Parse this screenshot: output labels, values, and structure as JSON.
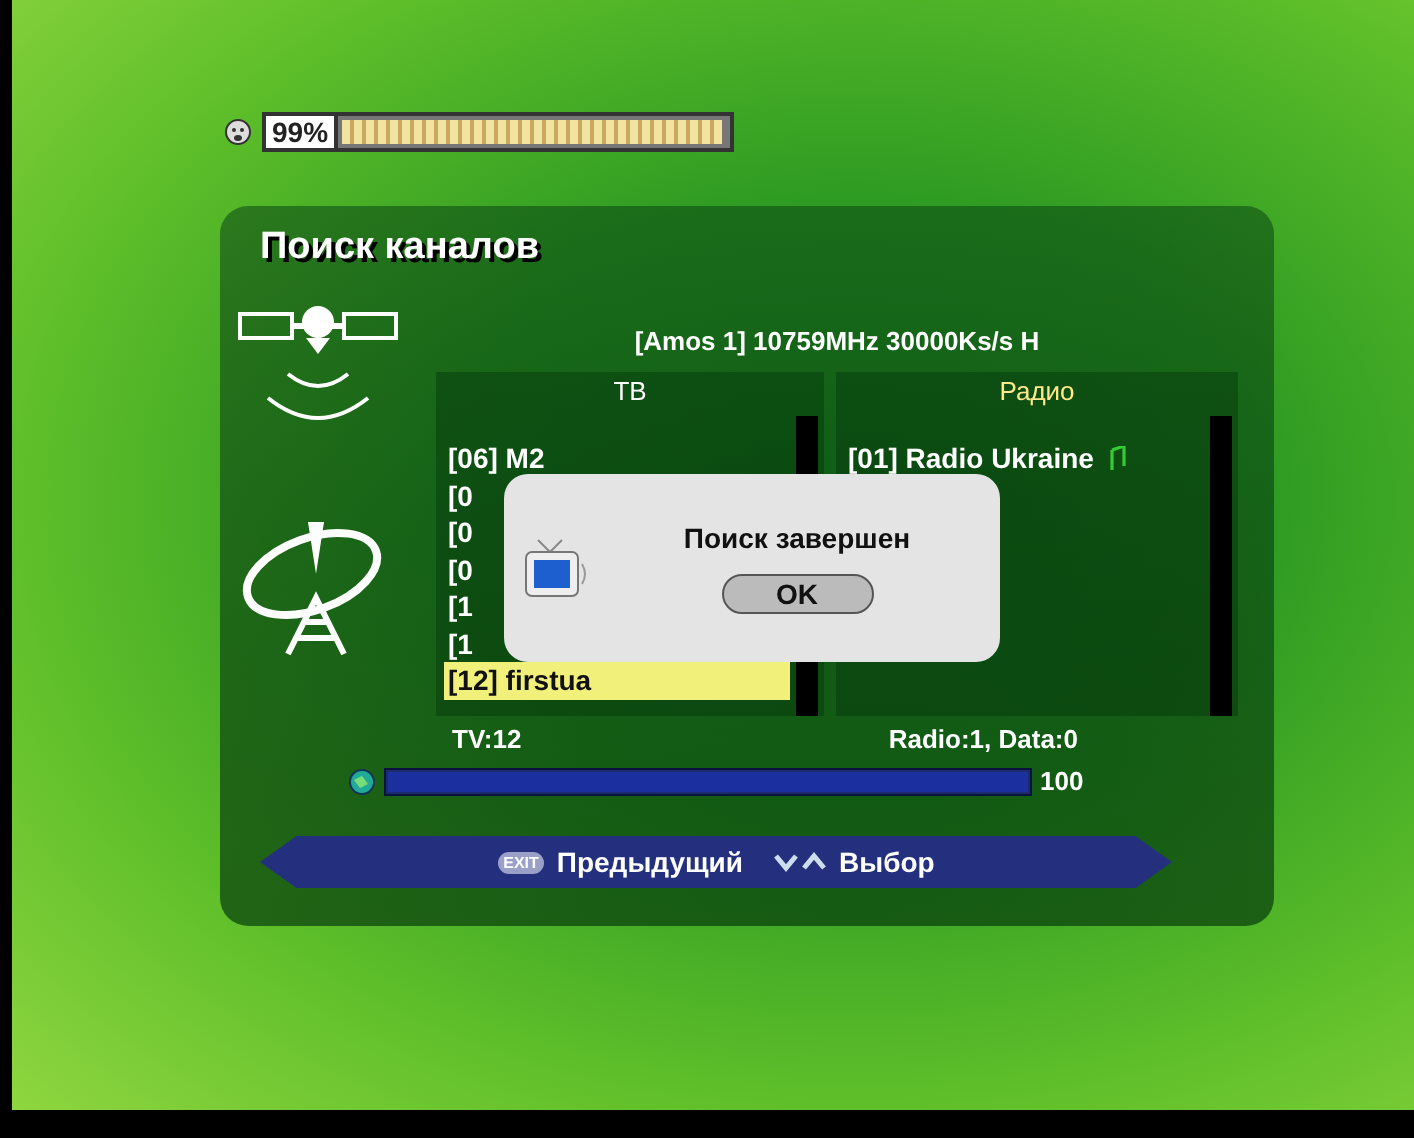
{
  "signal": {
    "reading": "99%",
    "level": 0.99
  },
  "title": "Поиск каналов",
  "transponder": "[Amos 1] 10759MHz 30000Ks/s H",
  "tv": {
    "heading": "ТВ",
    "count": "TV:12",
    "channels": [
      {
        "label": "[06] M2",
        "selected": false
      },
      {
        "label": "[0",
        "selected": false
      },
      {
        "label": "[0",
        "selected": false
      },
      {
        "label": "[0",
        "selected": false
      },
      {
        "label": "[1",
        "selected": false
      },
      {
        "label": "[1",
        "selected": false
      },
      {
        "label": "[12] firstua",
        "selected": true
      }
    ]
  },
  "radio": {
    "heading": "Радио",
    "count": "Radio:1, Data:0",
    "channels": [
      {
        "label": "[01] Radio Ukraine",
        "selected": false
      }
    ]
  },
  "progress": {
    "level": 1,
    "reading": "100"
  },
  "help": [
    {
      "kind": "key",
      "key": "EXIT",
      "label": "Предыдущий"
    },
    {
      "kind": "arrows",
      "label": "Выбор"
    }
  ],
  "dialog": {
    "message": "Поиск завершен",
    "button": "OK"
  }
}
